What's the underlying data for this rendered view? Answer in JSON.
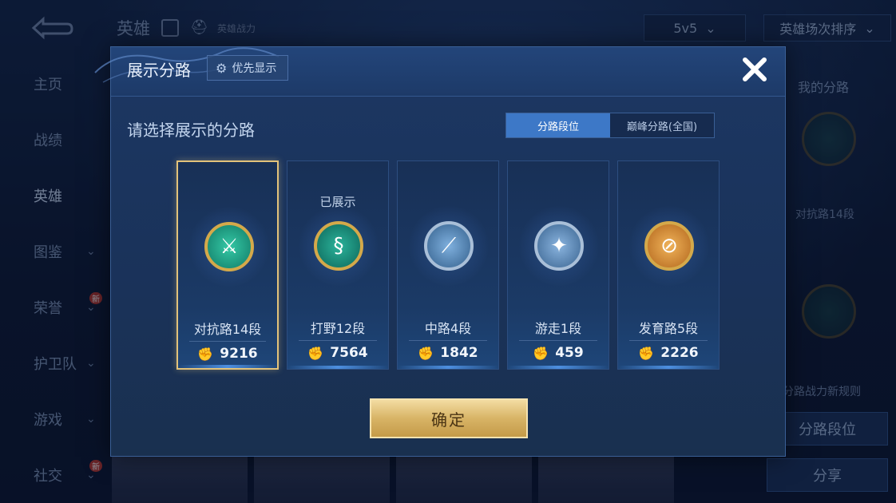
{
  "background": {
    "top_title": "英雄",
    "top_subtitle": "英雄战力",
    "mode_select": "5v5",
    "sort_select": "英雄场次排序",
    "nav": [
      {
        "label": "主页",
        "chevron": false,
        "new": false
      },
      {
        "label": "战绩",
        "chevron": false,
        "new": false
      },
      {
        "label": "英雄",
        "chevron": false,
        "new": false
      },
      {
        "label": "图鉴",
        "chevron": true,
        "new": false
      },
      {
        "label": "荣誉",
        "chevron": true,
        "new": true
      },
      {
        "label": "护卫队",
        "chevron": true,
        "new": false
      },
      {
        "label": "游戏",
        "chevron": true,
        "new": false
      },
      {
        "label": "社交",
        "chevron": true,
        "new": true
      }
    ],
    "new_tag": "新",
    "right_panel": {
      "title": "我的分路",
      "lane_label": "对抗路14段",
      "rule_text": "分路战力新规则",
      "lane_rank_button": "分路段位",
      "share_button": "分享"
    }
  },
  "dialog": {
    "title": "展示分路",
    "priority_button": "优先显示",
    "prompt": "请选择展示的分路",
    "segment": {
      "active": "分路段位",
      "inactive": "巅峰分路(全国)"
    },
    "shown_tag": "已展示",
    "confirm_button": "确定",
    "lanes": [
      {
        "name": "对抗路14段",
        "power": "9216",
        "selected": true,
        "shown": false,
        "emblem": "crossed-swords-icon",
        "emblem_color": "#1fa38a",
        "ring": "gold"
      },
      {
        "name": "打野12段",
        "power": "7564",
        "selected": false,
        "shown": true,
        "emblem": "dragon-icon",
        "emblem_color": "#178c7c",
        "ring": "gold"
      },
      {
        "name": "中路4段",
        "power": "1842",
        "selected": false,
        "shown": false,
        "emblem": "staff-icon",
        "emblem_color": "#4d7ca8",
        "ring": "silver"
      },
      {
        "name": "游走1段",
        "power": "459",
        "selected": false,
        "shown": false,
        "emblem": "wings-icon",
        "emblem_color": "#5379a3",
        "ring": "silver"
      },
      {
        "name": "发育路5段",
        "power": "2226",
        "selected": false,
        "shown": false,
        "emblem": "bow-icon",
        "emblem_color": "#d98b2b",
        "ring": "gold"
      }
    ]
  }
}
